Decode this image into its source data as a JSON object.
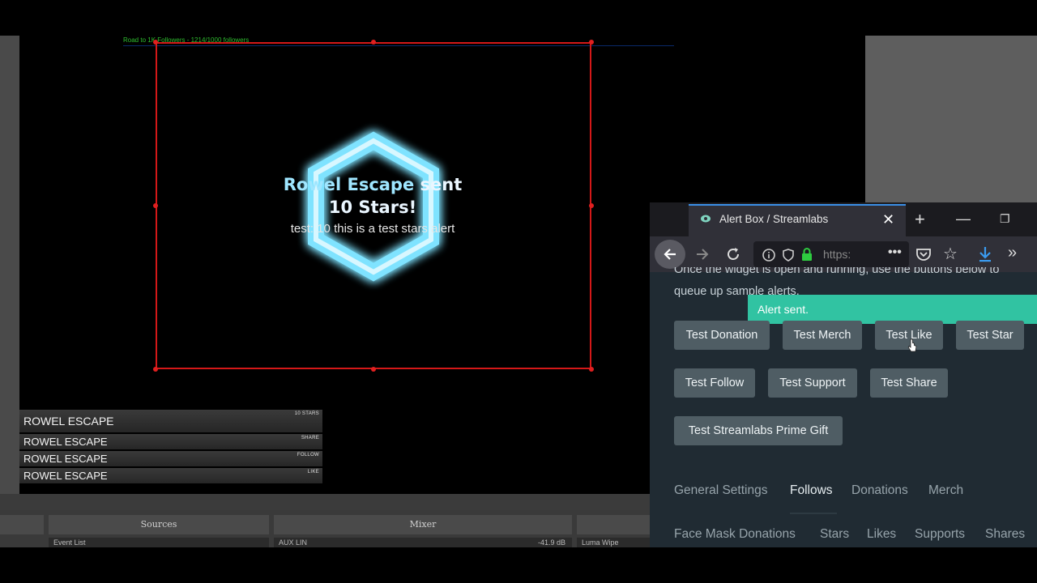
{
  "preview": {
    "goal_text": "Road to 1K Followers  -  1214/1000 followers",
    "alert": {
      "name": "Rowel Escape",
      "rest": " sent",
      "amount": "10 Stars!",
      "message": "test: 10 this is a test stars alert"
    },
    "hex_color": "#7fe3ff"
  },
  "event_list": [
    {
      "name": "ROWEL ESCAPE",
      "type": "10 STARS"
    },
    {
      "name": "ROWEL ESCAPE",
      "type": "SHARE"
    },
    {
      "name": "ROWEL ESCAPE",
      "type": "FOLLOW"
    },
    {
      "name": "ROWEL ESCAPE",
      "type": "LIKE"
    }
  ],
  "obs_docks": {
    "sources_label": "Sources",
    "mixer_label": "Mixer",
    "source_item": "Event List",
    "mixer_item": "AUX LIN",
    "mixer_db": "-41.9 dB",
    "transition_item": "Luma Wipe"
  },
  "browser": {
    "tab_title": "Alert Box / Streamlabs",
    "url": "https:",
    "accent": "#31c3a2"
  },
  "page": {
    "intro_line1": "Once the widget is open and running, use the buttons below to",
    "intro_line2": "queue up sample alerts.",
    "toast": "Alert sent.",
    "test_buttons": [
      "Test Donation",
      "Test Merch",
      "Test Like",
      "Test Star",
      "Test Follow",
      "Test Support",
      "Test Share",
      "Test Streamlabs Prime Gift"
    ],
    "settings_tabs": [
      "General Settings",
      "Follows",
      "Donations",
      "Merch"
    ],
    "active_tab": "Follows",
    "settings_tabs_row2": [
      "Face Mask Donations",
      "Stars",
      "Likes",
      "Supports",
      "Shares"
    ]
  }
}
